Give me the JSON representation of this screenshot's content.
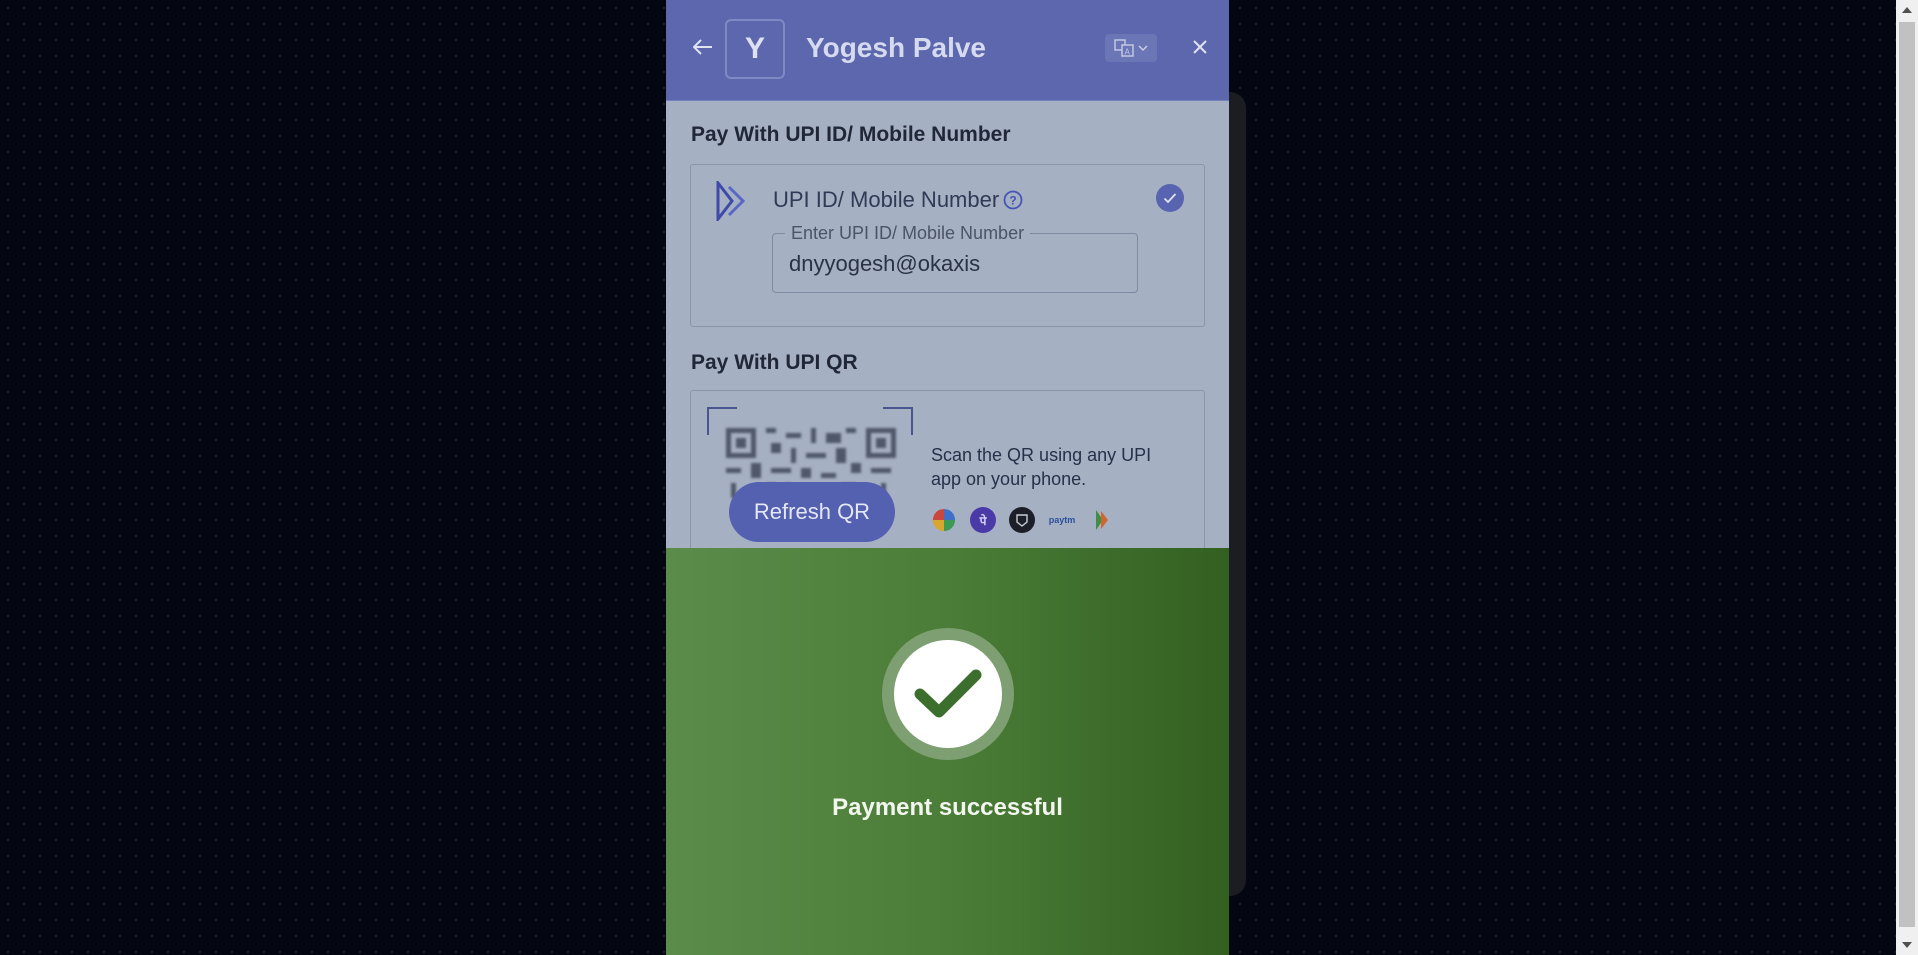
{
  "header": {
    "back_icon": "arrow-left-icon",
    "avatar_letter": "Y",
    "merchant_name": "Yogesh Palve",
    "language_icon": "translate-icon",
    "close_icon": "close-icon"
  },
  "upi_id_section": {
    "title": "Pay With UPI ID/ Mobile Number",
    "option_label": "UPI ID/ Mobile Number",
    "help_icon": "question-circle-icon",
    "selected": true,
    "field": {
      "label": "Enter UPI ID/ Mobile Number",
      "value": "dnyyogesh@okaxis"
    }
  },
  "upi_qr_section": {
    "title": "Pay With UPI QR",
    "refresh_label": "Refresh QR",
    "instruction": "Scan the QR using any UPI app on your phone.",
    "apps": [
      {
        "name": "google-pay-icon"
      },
      {
        "name": "phonepe-icon",
        "glyph": "पे"
      },
      {
        "name": "cred-icon"
      },
      {
        "name": "paytm-icon",
        "glyph": "paytm"
      },
      {
        "name": "bhim-icon"
      }
    ]
  },
  "success": {
    "icon": "checkmark-icon",
    "message": "Payment successful"
  },
  "colors": {
    "page_background": "#040711",
    "header": "#5c67ad",
    "modal_overlay": "#a6b0c3",
    "success_green": "#4b7d38"
  }
}
